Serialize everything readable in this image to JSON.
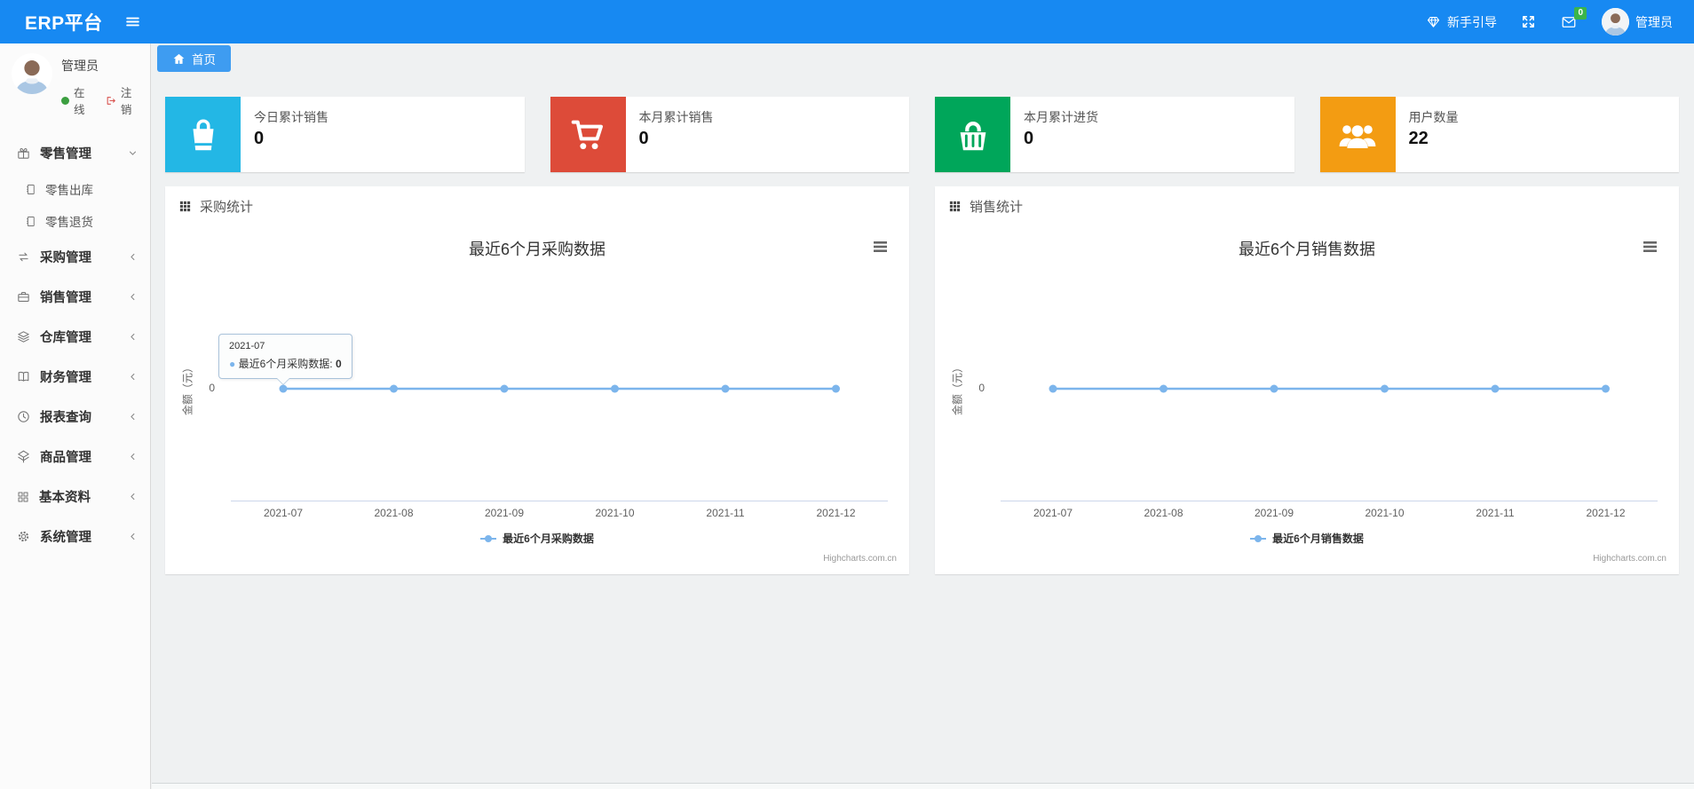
{
  "topbar": {
    "logo": "ERP平台",
    "guide_label": "新手引导",
    "mail_badge_count": "0",
    "username": "管理员"
  },
  "sidebar": {
    "user": {
      "name": "管理员",
      "status_online": "在线",
      "logout_label": "注销"
    },
    "menu": [
      {
        "label": "零售管理",
        "icon": "gift-icon",
        "expanded": true,
        "children": [
          {
            "label": "零售出库",
            "icon": "journal-icon"
          },
          {
            "label": "零售退货",
            "icon": "journal-icon"
          }
        ]
      },
      {
        "label": "采购管理",
        "icon": "exchange-icon"
      },
      {
        "label": "销售管理",
        "icon": "briefcase-icon"
      },
      {
        "label": "仓库管理",
        "icon": "layers-icon"
      },
      {
        "label": "财务管理",
        "icon": "open-book-icon"
      },
      {
        "label": "报表查询",
        "icon": "clock-icon"
      },
      {
        "label": "商品管理",
        "icon": "box-icon"
      },
      {
        "label": "基本资料",
        "icon": "grid-icon"
      },
      {
        "label": "系统管理",
        "icon": "gear-icon"
      }
    ]
  },
  "tabs": [
    {
      "label": "首页",
      "icon": "home-icon",
      "active": true
    }
  ],
  "stat_cards": [
    {
      "title": "今日累计销售",
      "value": "0",
      "color": "#23b7e5",
      "icon": "shopping-bag-icon"
    },
    {
      "title": "本月累计销售",
      "value": "0",
      "color": "#dd4b39",
      "icon": "cart-icon"
    },
    {
      "title": "本月累计进货",
      "value": "0",
      "color": "#00a65a",
      "icon": "basket-icon"
    },
    {
      "title": "用户数量",
      "value": "22",
      "color": "#f39c12",
      "icon": "users-icon"
    }
  ],
  "panels": [
    {
      "title": "采购统计"
    },
    {
      "title": "销售统计"
    }
  ],
  "chart_data": [
    {
      "type": "line",
      "title": "最近6个月采购数据",
      "categories": [
        "2021-07",
        "2021-08",
        "2021-09",
        "2021-10",
        "2021-11",
        "2021-12"
      ],
      "series": [
        {
          "name": "最近6个月采购数据",
          "color": "#7cb5ec",
          "values": [
            0,
            0,
            0,
            0,
            0,
            0
          ]
        }
      ],
      "xlabel": "",
      "ylabel": "金额（元）",
      "yticks": [
        "0"
      ],
      "ylim": [
        -1,
        1
      ],
      "grid": false,
      "legend_position": "bottom",
      "tooltip": {
        "category": "2021-07",
        "series_name": "最近6个月采购数据",
        "value": "0",
        "point_index": 0
      }
    },
    {
      "type": "line",
      "title": "最近6个月销售数据",
      "categories": [
        "2021-07",
        "2021-08",
        "2021-09",
        "2021-10",
        "2021-11",
        "2021-12"
      ],
      "series": [
        {
          "name": "最近6个月销售数据",
          "color": "#7cb5ec",
          "values": [
            0,
            0,
            0,
            0,
            0,
            0
          ]
        }
      ],
      "xlabel": "",
      "ylabel": "金额（元）",
      "yticks": [
        "0"
      ],
      "ylim": [
        -1,
        1
      ],
      "grid": false,
      "legend_position": "bottom"
    }
  ],
  "attribution": "Highcharts.com.cn"
}
